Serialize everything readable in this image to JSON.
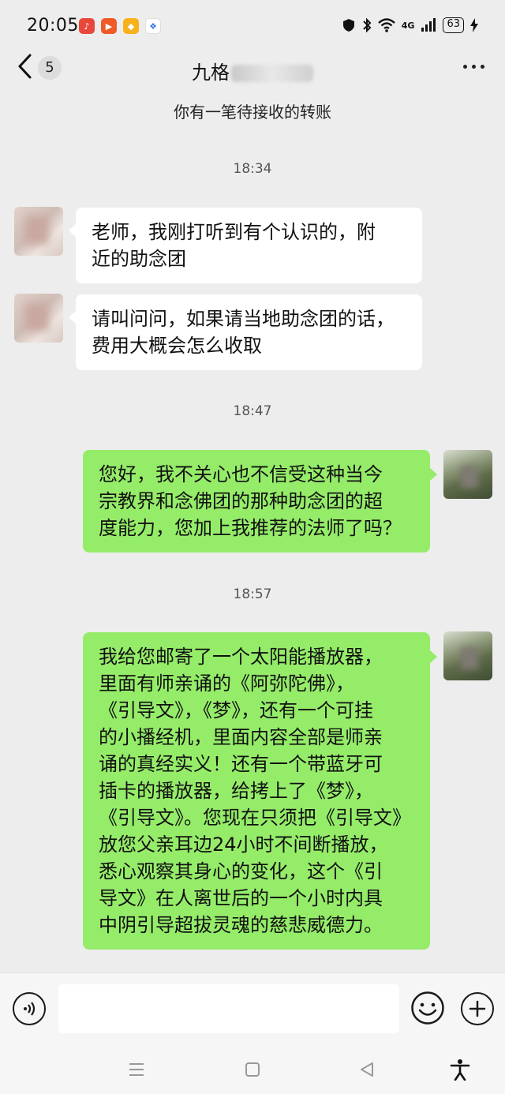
{
  "status_bar": {
    "time": "20:05",
    "network": "4G",
    "battery": "63"
  },
  "nav": {
    "unread_count": "5",
    "title": "九格"
  },
  "transfer_notice": "你有一笔待接收的转账",
  "messages": [
    {
      "type": "timestamp",
      "text": "18:34"
    },
    {
      "type": "received",
      "text": "老师，我刚打听到有个认识的，附\n近的助念团"
    },
    {
      "type": "received",
      "text": "请叫问问，如果请当地助念团的话，\n费用大概会怎么收取"
    },
    {
      "type": "timestamp",
      "text": "18:47"
    },
    {
      "type": "sent",
      "text": "您好，我不关心也不信受这种当今\n宗教界和念佛团的那种助念团的超\n度能力，您加上我推荐的法师了吗？"
    },
    {
      "type": "timestamp",
      "text": "18:57"
    },
    {
      "type": "sent",
      "text": "我给您邮寄了一个太阳能播放器，\n里面有师亲诵的《阿弥陀佛》，\n《引导文》，《梦》，还有一个可挂\n的小播经机，里面内容全部是师亲\n诵的真经实义！还有一个带蓝牙可\n插卡的播放器，给拷上了《梦》，\n《引导文》。您现在只须把《引导文》\n放您父亲耳边24小时不间断播放，\n悉心观察其身心的变化，这个《引\n导文》在人离世后的一个小时内具\n中阴引导超拔灵魂的慈悲威德力。"
    }
  ],
  "colors": {
    "background": "#ededed",
    "sent_bubble": "#95ec69",
    "received_bubble": "#ffffff"
  }
}
